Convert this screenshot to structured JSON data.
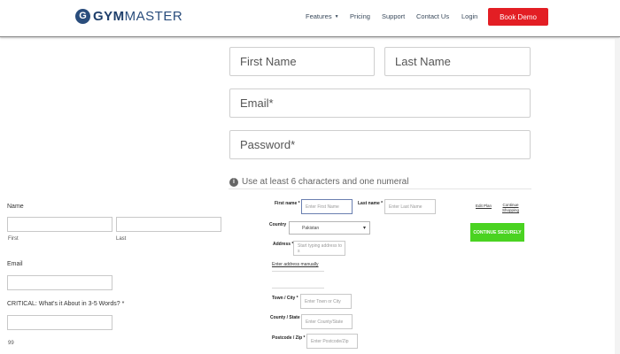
{
  "nav": {
    "logo_gym": "GYM",
    "logo_master": "MASTER",
    "features": "Features",
    "pricing": "Pricing",
    "support": "Support",
    "contact": "Contact Us",
    "login": "Login",
    "book_demo": "Book Demo"
  },
  "signup": {
    "first_name_placeholder": "First Name",
    "last_name_placeholder": "Last Name",
    "email_placeholder": "Email*",
    "password_placeholder": "Password*",
    "hint": "Use at least 6 characters and one numeral"
  },
  "left_form": {
    "name_label": "Name",
    "first_sub": "First",
    "last_sub": "Last",
    "email_label": "Email",
    "critical_label": "CRITICAL: What's it About in 3-5 Words? *",
    "counter": "99"
  },
  "checkout": {
    "first_name_label": "First name *",
    "first_name_placeholder": "Enter First Name",
    "last_name_label": "Last name *",
    "last_name_placeholder": "Enter Last Name",
    "country_label": "Country",
    "country_value": "Pakistan",
    "address_label": "Address *",
    "address_placeholder": "Start typing address to s",
    "manual_link": "Enter address manually",
    "town_label": "Town / City *",
    "town_placeholder": "Enter Town or City",
    "county_label": "County / State",
    "county_placeholder": "Enter County/State",
    "postcode_label": "Postcode / Zip *",
    "postcode_placeholder": "Enter Postcode/Zip",
    "edit_link": "Edit Plan",
    "continue_shopping_1": "Continue",
    "continue_shopping_2": "Shopping",
    "continue_button": "CONTINUE SECURELY"
  }
}
